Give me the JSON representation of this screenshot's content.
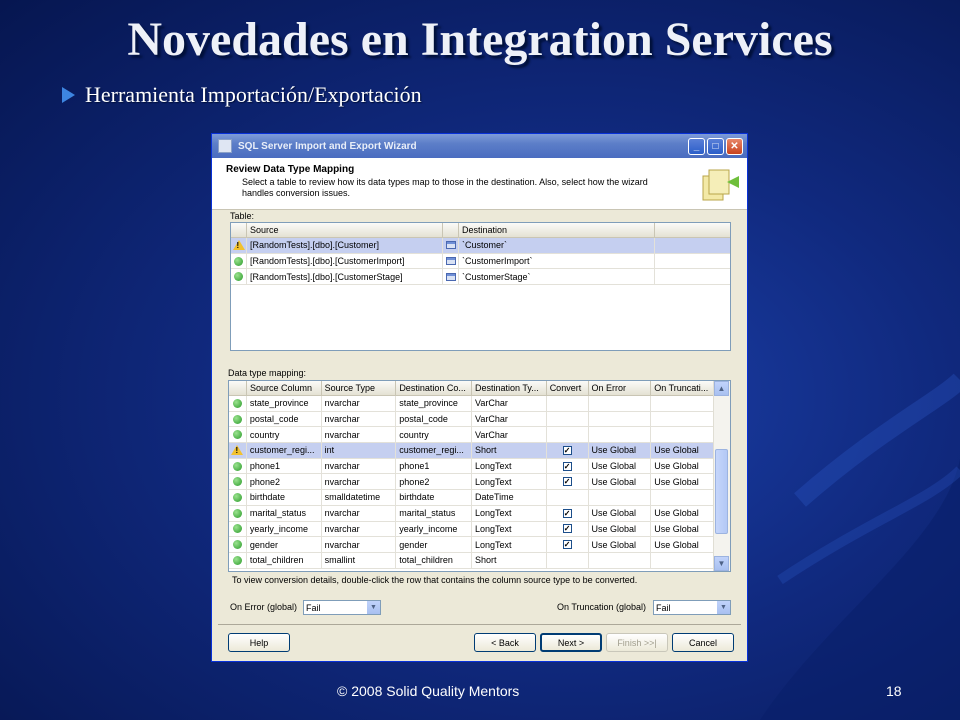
{
  "slide": {
    "title": "Novedades en Integration Services",
    "bullet": "Herramienta Importación/Exportación",
    "footer": "© 2008 Solid Quality Mentors",
    "page_number": "18"
  },
  "window": {
    "title": "SQL Server Import and Export Wizard",
    "minimize_glyph": "_",
    "maximize_glyph": "□",
    "close_glyph": "✕"
  },
  "header": {
    "title": "Review Data Type Mapping",
    "description": "Select a table to review how its data types map to those in the destination. Also, select how the wizard handles conversion issues."
  },
  "table_section": {
    "label": "Table:",
    "columns": [
      "Source",
      "Destination"
    ],
    "rows": [
      {
        "status": "warning",
        "source": "[RandomTests].[dbo].[Customer]",
        "destination": "`Customer`",
        "selected": true
      },
      {
        "status": "ok",
        "source": "[RandomTests].[dbo].[CustomerImport]",
        "destination": "`CustomerImport`",
        "selected": false
      },
      {
        "status": "ok",
        "source": "[RandomTests].[dbo].[CustomerStage]",
        "destination": "`CustomerStage`",
        "selected": false
      }
    ]
  },
  "mapping_section": {
    "label": "Data type mapping:",
    "columns": [
      "Source Column",
      "Source Type",
      "Destination Co...",
      "Destination Ty...",
      "Convert",
      "On Error",
      "On Truncati..."
    ],
    "rows": [
      {
        "status": "ok",
        "source_column": "state_province",
        "source_type": "nvarchar",
        "dest_column": "state_province",
        "dest_type": "VarChar",
        "convert": false,
        "on_error": "",
        "on_truncation": "",
        "selected": false
      },
      {
        "status": "ok",
        "source_column": "postal_code",
        "source_type": "nvarchar",
        "dest_column": "postal_code",
        "dest_type": "VarChar",
        "convert": false,
        "on_error": "",
        "on_truncation": "",
        "selected": false
      },
      {
        "status": "ok",
        "source_column": "country",
        "source_type": "nvarchar",
        "dest_column": "country",
        "dest_type": "VarChar",
        "convert": false,
        "on_error": "",
        "on_truncation": "",
        "selected": false
      },
      {
        "status": "warning",
        "source_column": "customer_regi...",
        "source_type": "int",
        "dest_column": "customer_regi...",
        "dest_type": "Short",
        "convert": true,
        "on_error": "Use Global",
        "on_truncation": "Use Global",
        "selected": true
      },
      {
        "status": "ok",
        "source_column": "phone1",
        "source_type": "nvarchar",
        "dest_column": "phone1",
        "dest_type": "LongText",
        "convert": true,
        "on_error": "Use Global",
        "on_truncation": "Use Global",
        "selected": false
      },
      {
        "status": "ok",
        "source_column": "phone2",
        "source_type": "nvarchar",
        "dest_column": "phone2",
        "dest_type": "LongText",
        "convert": true,
        "on_error": "Use Global",
        "on_truncation": "Use Global",
        "selected": false
      },
      {
        "status": "ok",
        "source_column": "birthdate",
        "source_type": "smalldatetime",
        "dest_column": "birthdate",
        "dest_type": "DateTime",
        "convert": false,
        "on_error": "",
        "on_truncation": "",
        "selected": false
      },
      {
        "status": "ok",
        "source_column": "marital_status",
        "source_type": "nvarchar",
        "dest_column": "marital_status",
        "dest_type": "LongText",
        "convert": true,
        "on_error": "Use Global",
        "on_truncation": "Use Global",
        "selected": false
      },
      {
        "status": "ok",
        "source_column": "yearly_income",
        "source_type": "nvarchar",
        "dest_column": "yearly_income",
        "dest_type": "LongText",
        "convert": true,
        "on_error": "Use Global",
        "on_truncation": "Use Global",
        "selected": false
      },
      {
        "status": "ok",
        "source_column": "gender",
        "source_type": "nvarchar",
        "dest_column": "gender",
        "dest_type": "LongText",
        "convert": true,
        "on_error": "Use Global",
        "on_truncation": "Use Global",
        "selected": false
      },
      {
        "status": "ok",
        "source_column": "total_children",
        "source_type": "smallint",
        "dest_column": "total_children",
        "dest_type": "Short",
        "convert": false,
        "on_error": "",
        "on_truncation": "",
        "selected": false
      }
    ],
    "hint": "To view conversion details, double-click the row that contains the column source type to be converted.",
    "scroll_up_glyph": "▲",
    "scroll_down_glyph": "▼"
  },
  "global_options": {
    "on_error_label": "On Error (global)",
    "on_error_value": "Fail",
    "on_truncation_label": "On Truncation (global)",
    "on_truncation_value": "Fail",
    "dropdown_glyph": "▼"
  },
  "buttons": {
    "help": "Help",
    "back": "< Back",
    "next": "Next >",
    "finish": "Finish >>|",
    "cancel": "Cancel"
  }
}
